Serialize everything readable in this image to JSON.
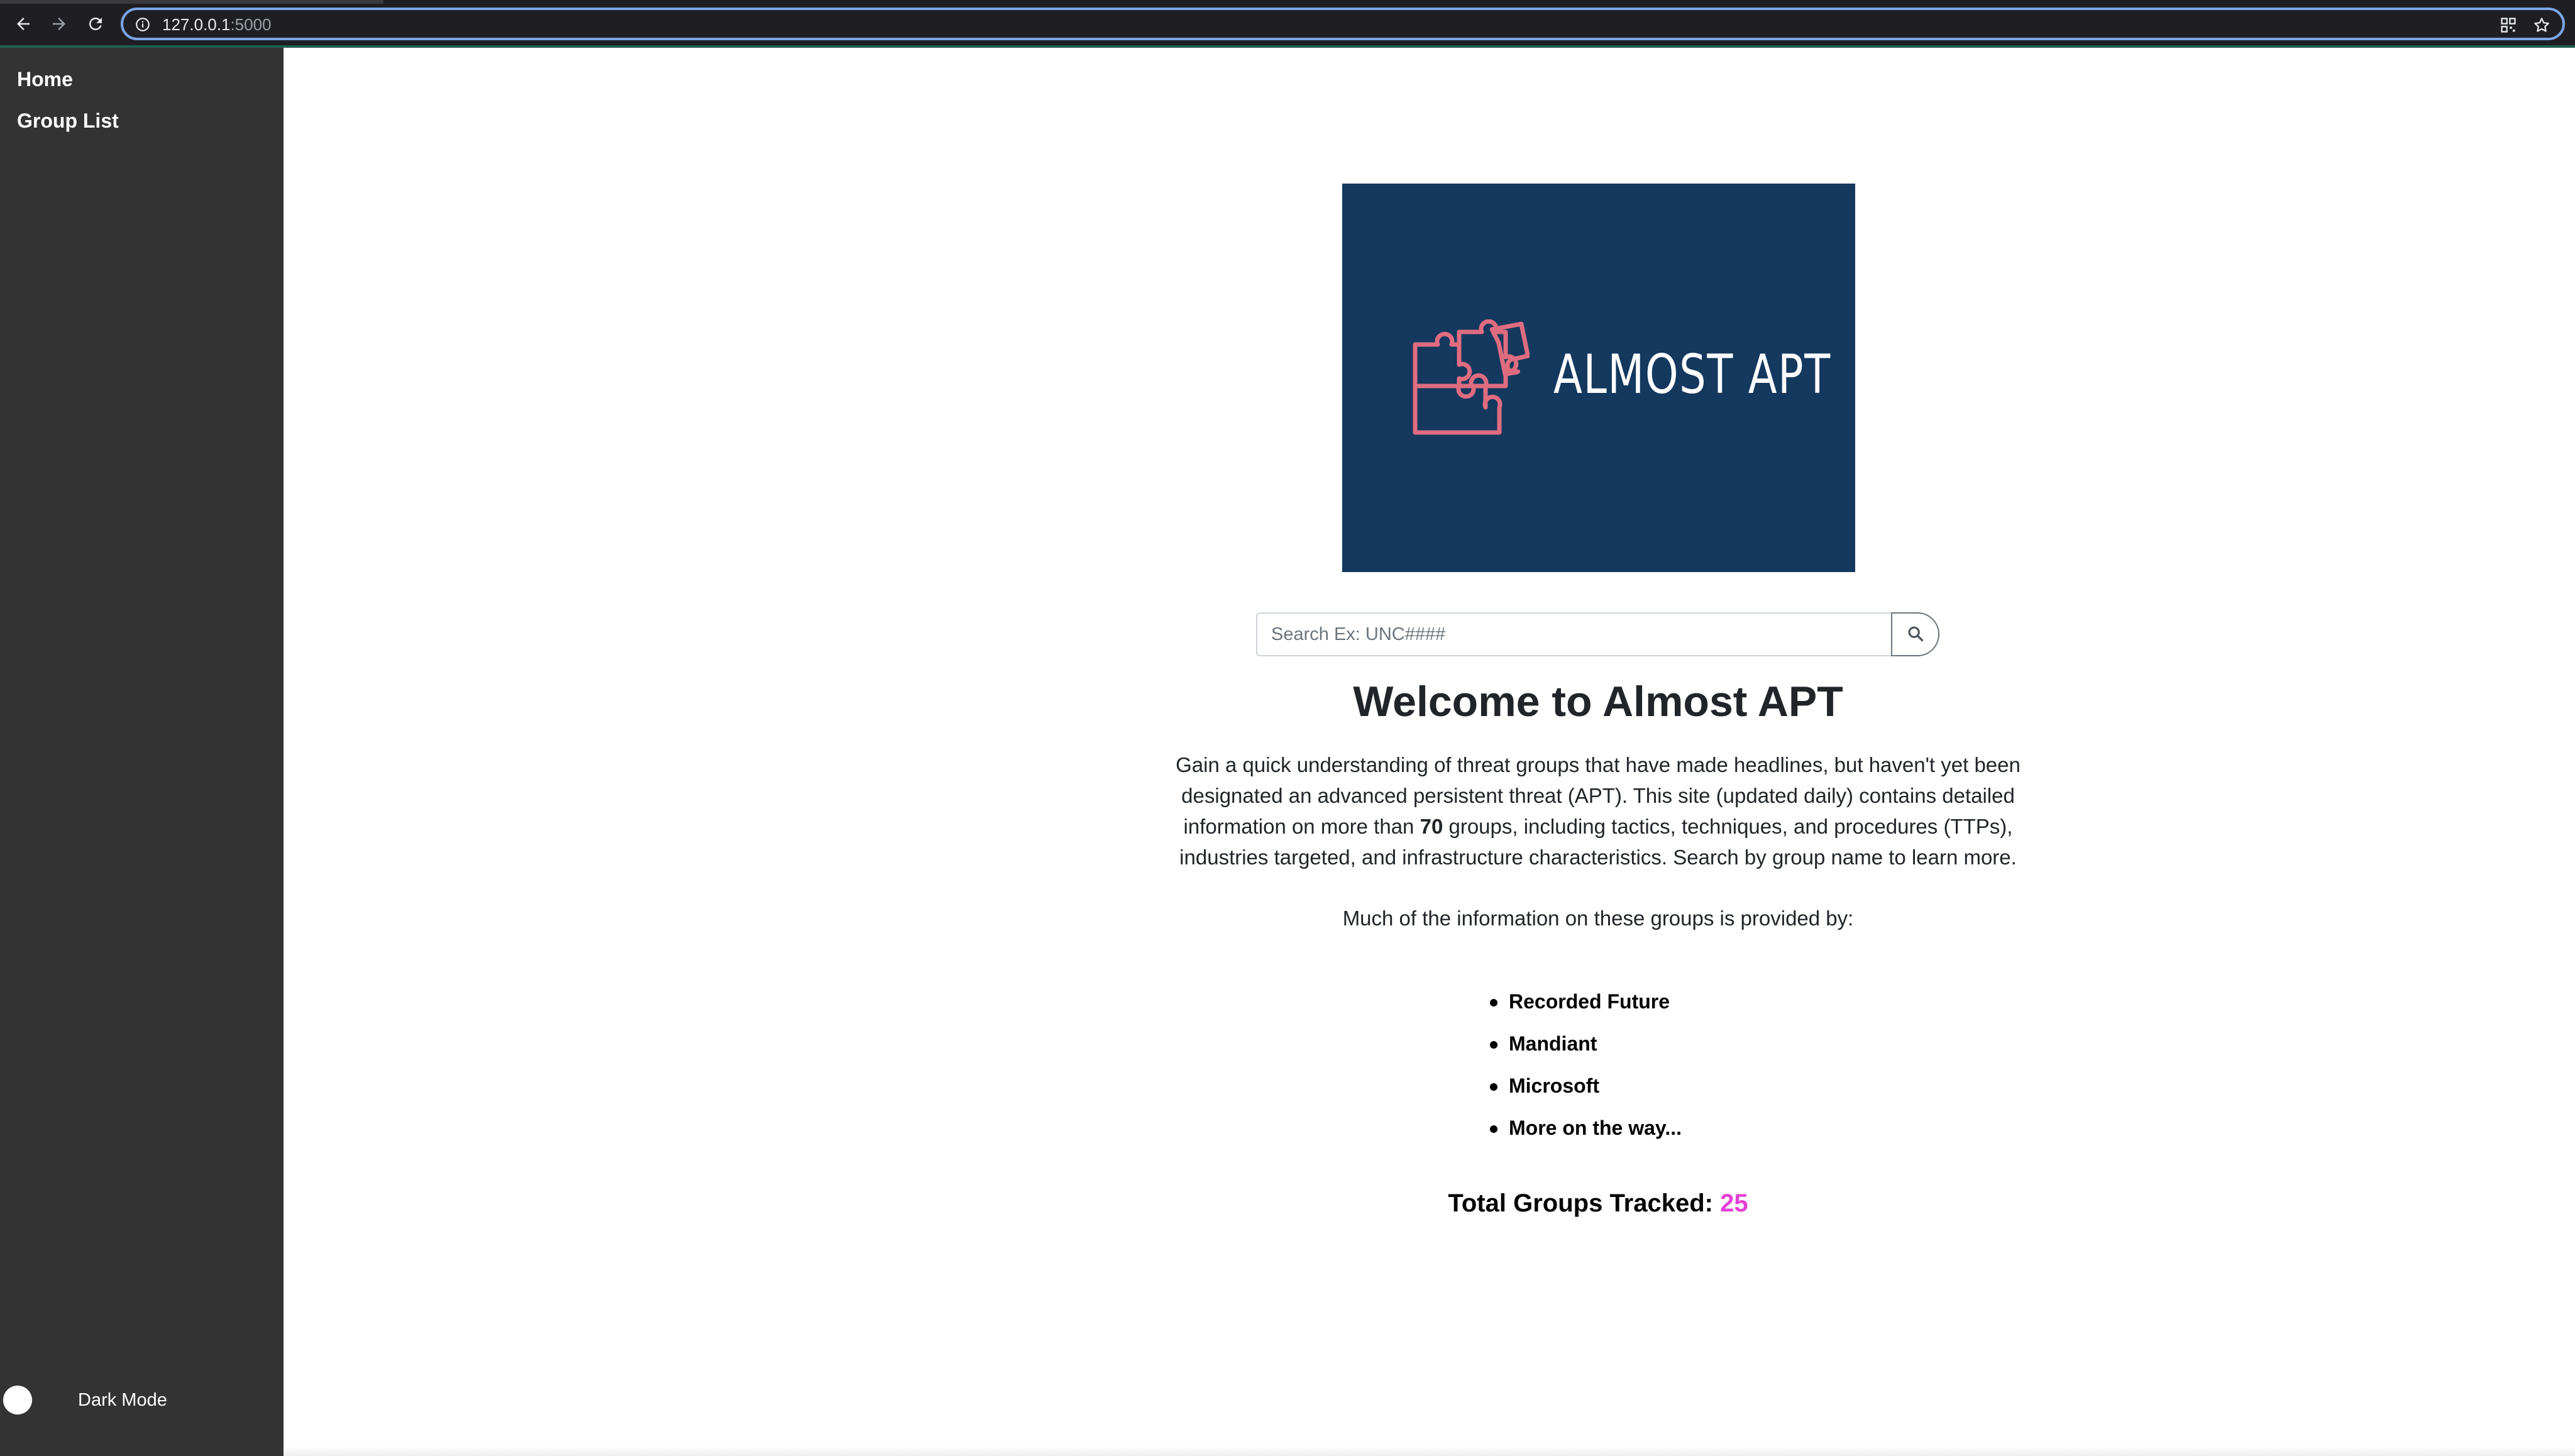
{
  "browser": {
    "url_host": "127.0.0.1",
    "url_port": ":5000"
  },
  "sidebar": {
    "items": [
      {
        "label": "Home"
      },
      {
        "label": "Group List"
      }
    ],
    "dark_mode_label": "Dark Mode"
  },
  "logo": {
    "text": "ALMOST APT",
    "icon": "puzzle-pieces-icon",
    "background_color": "#14385e",
    "accent_color": "#e06c80"
  },
  "search": {
    "placeholder": "Search Ex: UNC####",
    "value": "",
    "icon": "search-icon"
  },
  "main": {
    "title": "Welcome to Almost APT",
    "intro_before_count": "Gain a quick understanding of threat groups that have made headlines, but haven't yet been designated an advanced persistent threat (APT). This site (updated daily) contains detailed information on more than ",
    "intro_count": "70",
    "intro_after_count": " groups, including tactics, techniques, and procedures (TTPs), industries targeted, and infrastructure characteristics. Search by group name to learn more.",
    "provided_by": "Much of the information on these groups is provided by:",
    "sources": [
      "Recorded Future",
      "Mandiant",
      "Microsoft",
      "More on the way..."
    ],
    "total_label": "Total Groups Tracked: ",
    "total_count": "25",
    "total_count_color": "#e43fd6"
  }
}
